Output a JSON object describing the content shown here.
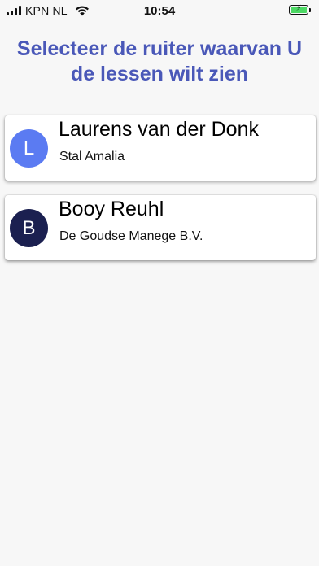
{
  "status_bar": {
    "carrier": "KPN NL",
    "time": "10:54",
    "battery_level": 1.0,
    "battery_charging": true
  },
  "heading": {
    "text": "Selecteer de ruiter waarvan U de lessen wilt zien",
    "color": "#4a58b8"
  },
  "riders": [
    {
      "initial": "L",
      "name": "Laurens van der Donk",
      "stable": "Stal Amalia",
      "avatar_color": "#5b7bf2"
    },
    {
      "initial": "B",
      "name": "Booy Reuhl",
      "stable": "De Goudse Manege B.V.",
      "avatar_color": "#1b2050"
    }
  ]
}
